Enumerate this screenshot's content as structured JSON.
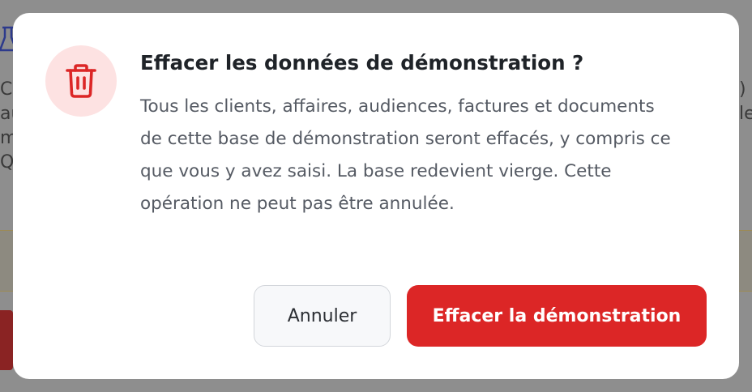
{
  "background": {
    "left_fragments": [
      "Ca",
      "au",
      "m",
      "Q"
    ],
    "right_fragments": [
      ")",
      "",
      "le",
      ""
    ]
  },
  "dialog": {
    "icon": "trash-icon",
    "title": "Effacer les données de démonstration ?",
    "message": "Tous les clients, affaires, audiences, factures et documents de cette base de démonstration seront effacés, y compris ce que vous y avez saisi. La base redevient vierge. Cette opération ne peut pas être annulée.",
    "cancel_label": "Annuler",
    "confirm_label": "Effacer la démonstration"
  },
  "colors": {
    "danger": "#dc2626",
    "danger_tint": "#fde2e2",
    "overlay": "#8e8e8e"
  }
}
